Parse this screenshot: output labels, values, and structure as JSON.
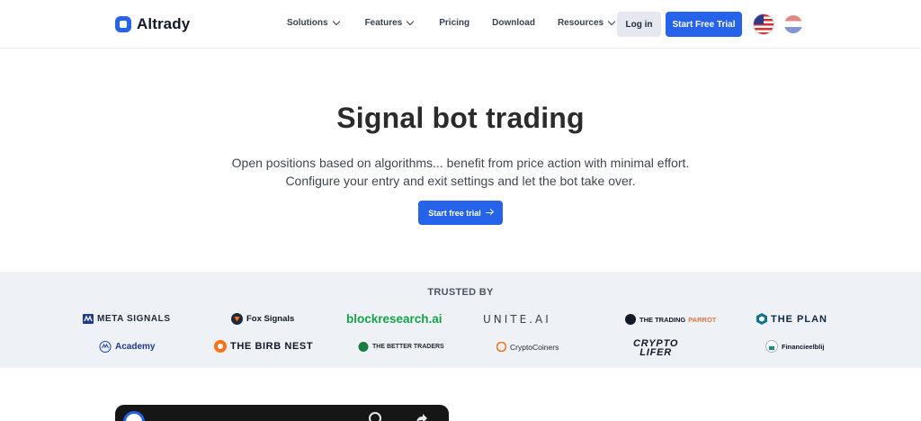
{
  "header": {
    "brand": "Altrady",
    "nav": {
      "solutions": "Solutions",
      "features": "Features",
      "pricing": "Pricing",
      "download": "Download",
      "resources": "Resources"
    },
    "login_label": "Log in",
    "trial_label": "Start Free Trial",
    "language_flags": [
      "us-flag-icon",
      "nl-flag-icon"
    ]
  },
  "hero": {
    "title": "Signal bot trading",
    "subtitle_line1": "Open positions based on algorithms... benefit from price action with minimal effort.",
    "subtitle_line2": "Configure your entry and exit settings and let the bot take over.",
    "cta_label": "Start free trial"
  },
  "trusted": {
    "title": "TRUSTED BY",
    "partners": {
      "meta_signals": "META SIGNALS",
      "fox_signals": "Fox Signals",
      "blockresearch": "blockresearch.ai",
      "unite_ai": "UNITE.AI",
      "trading_parrot_a": "THE TRADING",
      "trading_parrot_b": "PARROT",
      "the_plan": "THE PLAN",
      "academy": "Academy",
      "birb_nest": "THE BIRB NEST",
      "better_traders": "THE BETTER TRADERS",
      "cryptocoiners": "CryptoCoiners",
      "crypto_lifer_a": "CRYPTO",
      "crypto_lifer_b": "LIFER",
      "financieelblij": "Financieelblij"
    }
  },
  "colors": {
    "accent": "#2563eb",
    "band": "#eef1f5",
    "blockresearch": "#16a34a",
    "parrot": "#e8734a"
  }
}
